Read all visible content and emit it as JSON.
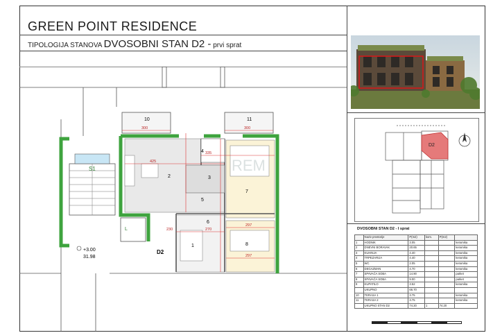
{
  "header": {
    "title": "GREEN POINT RESIDENCE",
    "subtitle_prefix": "TIPOLOGIJA STANOVA",
    "subtitle_main": "DVOSOBNI STAN  D2 -",
    "subtitle_suffix": "prvi sprat"
  },
  "plan": {
    "room_numbers": [
      "1",
      "2",
      "3",
      "4",
      "5",
      "6",
      "7",
      "8",
      "10",
      "11"
    ],
    "dimensions": [
      "300",
      "300",
      "425",
      "335",
      "297",
      "297",
      "230",
      "270"
    ],
    "stair_label": "S1",
    "unit_label": "D2",
    "level_mark": "+3.00",
    "level_value": "31.98",
    "watermark": "REM"
  },
  "keyplan": {
    "unit_label": "D2"
  },
  "table": {
    "title": "DVOSOBNI STAN D2 - I sprat",
    "headers": [
      "",
      "Naziv prostorije",
      "P(m2)",
      "kom.",
      "P(m2)",
      ""
    ],
    "rows": [
      [
        "1",
        "HODNIK",
        "3.05",
        "",
        "",
        "keramika"
      ],
      [
        "2",
        "DNEVNI BORAVAK",
        "20.65",
        "",
        "",
        "keramika"
      ],
      [
        "3",
        "KUHINJA",
        "4.40",
        "",
        "",
        "keramika"
      ],
      [
        "4",
        "TRPEZARIJA",
        "4.40",
        "",
        "",
        "keramika"
      ],
      [
        "5",
        "WC",
        "2.05",
        "",
        "",
        "keramika"
      ],
      [
        "6",
        "DEGAZMAN",
        "4.70",
        "",
        "",
        "keramika"
      ],
      [
        "7",
        "SPAVAĆA SOBA",
        "14.90",
        "",
        "",
        "parket"
      ],
      [
        "8",
        "SPAVAĆA SOBA",
        "9.00",
        "",
        "",
        "parket"
      ],
      [
        "9",
        "KUPATILO",
        "3.52",
        "",
        "",
        "keramika"
      ],
      [
        "",
        "UKUPNO",
        "66.70",
        "",
        "",
        ""
      ],
      [
        "10",
        "TERASA 1",
        "3.75",
        "",
        "",
        "keramika"
      ],
      [
        "11",
        "TERASA 2",
        "3.75",
        "",
        "",
        "keramika"
      ],
      [
        "",
        "UKUPNO STAN D2",
        "74.20",
        "1",
        "74.20",
        ""
      ]
    ]
  }
}
